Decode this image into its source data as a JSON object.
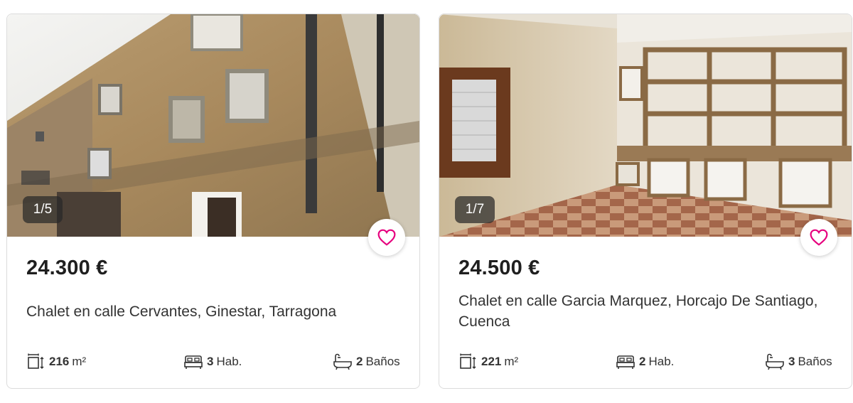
{
  "listings": [
    {
      "photo_counter": "1/5",
      "price": "24.300 €",
      "title": "Chalet en calle Cervantes, Ginestar, Tarragona",
      "area_value": "216",
      "area_unit": "m²",
      "rooms_value": "3",
      "rooms_label": "Hab.",
      "baths_value": "2",
      "baths_label": "Baños",
      "favorite_icon": "heart-outline-icon"
    },
    {
      "photo_counter": "1/7",
      "price": "24.500 €",
      "title": "Chalet en calle Garcia Marquez, Horcajo De Santiago, Cuenca",
      "area_value": "221",
      "area_unit": "m²",
      "rooms_value": "2",
      "rooms_label": "Hab.",
      "baths_value": "3",
      "baths_label": "Baños",
      "favorite_icon": "heart-outline-icon"
    }
  ],
  "colors": {
    "accent": "#e6007e",
    "card_border": "#dcdcdc",
    "text": "#212121"
  }
}
